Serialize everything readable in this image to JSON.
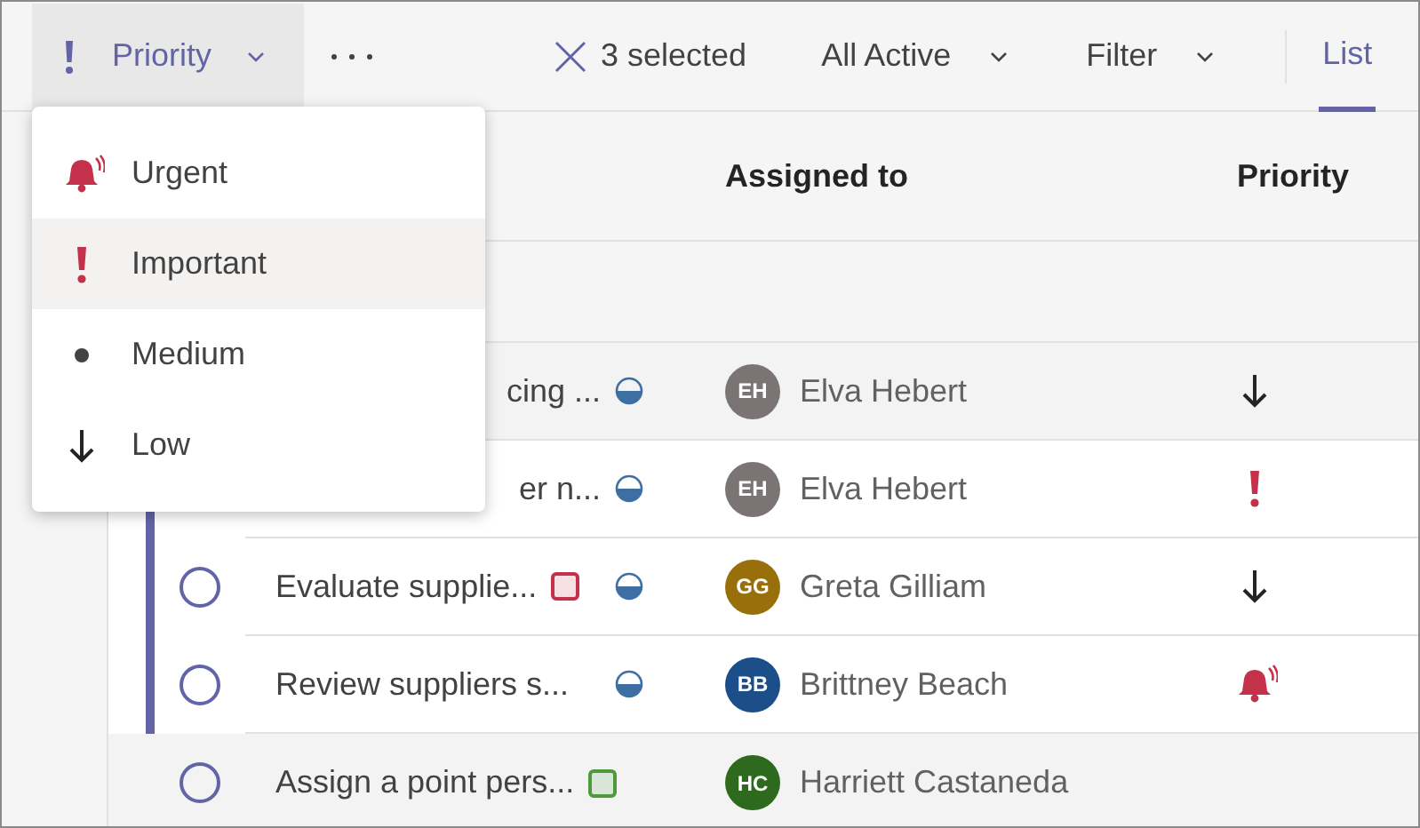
{
  "toolbar": {
    "priority_button": {
      "label": "Priority",
      "hovered": true
    },
    "selection": {
      "label": "3 selected"
    },
    "views": [
      {
        "label": "All Active"
      },
      {
        "label": "Filter"
      }
    ],
    "tabs": [
      {
        "label": "List",
        "selected": true
      }
    ]
  },
  "columns": [
    {
      "label": "Assigned to"
    },
    {
      "label": "Priority"
    }
  ],
  "rows": [
    {
      "task": "cing ...",
      "selected": false,
      "in_progress": true,
      "assignee": {
        "initials": "EH",
        "name": "Elva Hebert",
        "color": "#7a7574"
      },
      "priority": {
        "kind": "low"
      }
    },
    {
      "task": "er n...",
      "selected": true,
      "in_progress": true,
      "assignee": {
        "initials": "EH",
        "name": "Elva Hebert",
        "color": "#7a7574"
      },
      "priority": {
        "kind": "important"
      }
    },
    {
      "task": "Evaluate supplie...",
      "done": false,
      "selected": true,
      "label": {
        "color": "#c4314b"
      },
      "in_progress": true,
      "assignee": {
        "initials": "GG",
        "name": "Greta Gilliam",
        "color": "#986f0b"
      },
      "priority": {
        "kind": "low"
      }
    },
    {
      "task": "Review suppliers s...",
      "done": false,
      "selected": true,
      "in_progress": true,
      "assignee": {
        "initials": "BB",
        "name": "Brittney Beach",
        "color": "#1c4f8a"
      },
      "priority": {
        "kind": "urgent"
      }
    },
    {
      "task": "Assign a point pers...",
      "done": false,
      "selected": false,
      "label": {
        "color": "#4c9a3a"
      },
      "in_progress": false,
      "assignee": {
        "initials": "HC",
        "name": "Harriett Castaneda",
        "color": "#2d6a1e"
      }
    }
  ],
  "priority_menu": {
    "items": [
      {
        "kind": "urgent",
        "label": "Urgent",
        "highlighted": false
      },
      {
        "kind": "important",
        "label": "Important",
        "highlighted": true
      },
      {
        "kind": "medium",
        "label": "Medium",
        "highlighted": false
      },
      {
        "kind": "low",
        "label": "Low",
        "highlighted": false
      }
    ]
  }
}
